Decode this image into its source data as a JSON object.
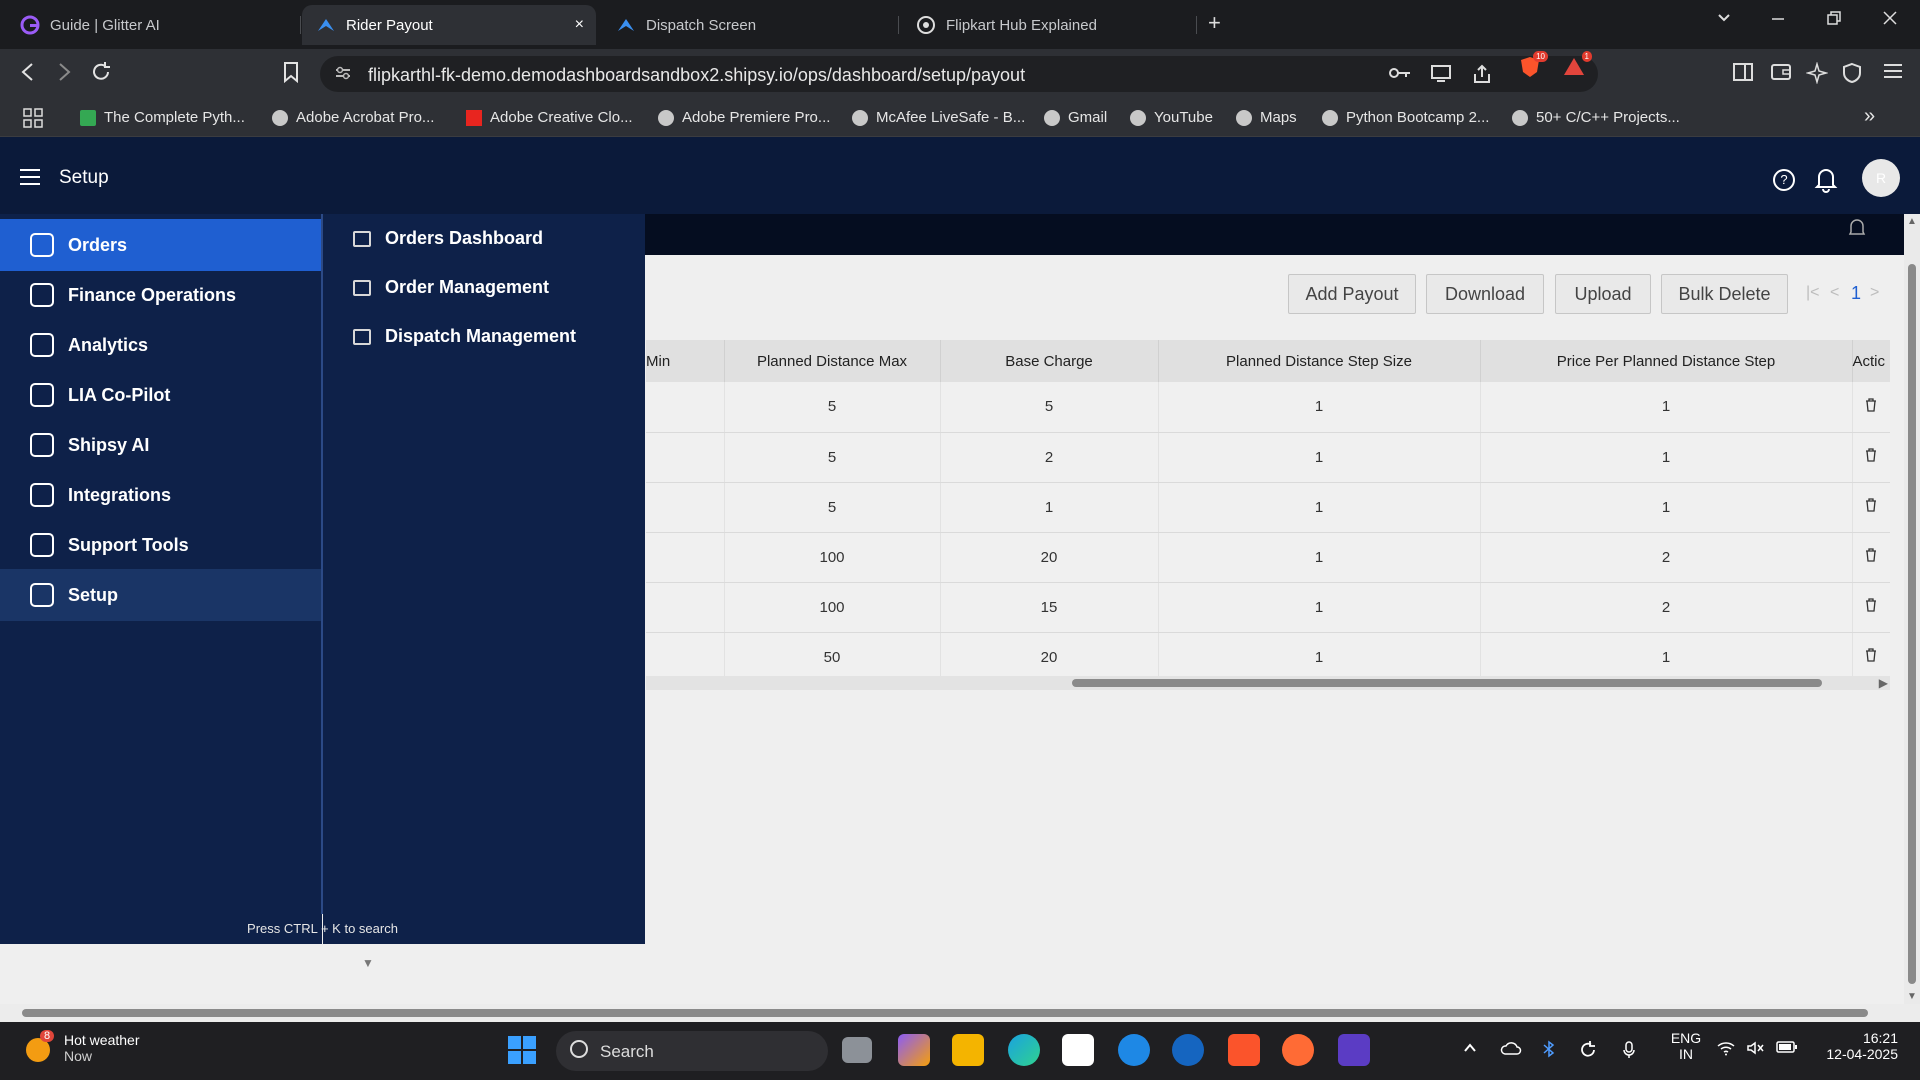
{
  "browser": {
    "tabs": [
      {
        "title": "Guide | Glitter AI",
        "active": false
      },
      {
        "title": "Rider Payout",
        "active": true
      },
      {
        "title": "Dispatch Screen",
        "active": false
      },
      {
        "title": "Flipkart Hub Explained",
        "active": false
      }
    ],
    "close_glyph": "×",
    "new_tab_glyph": "+",
    "url": "flipkarthl-fk-demo.demodashboardsandbox2.shipsy.io/ops/dashboard/setup/payout",
    "brave_badge": "10",
    "alert_badge": "1",
    "bookmarks": [
      "The Complete Pyth...",
      "Adobe Acrobat Pro...",
      "Adobe Creative Clo...",
      "Adobe Premiere Pro...",
      "McAfee LiveSafe - B...",
      "Gmail",
      "YouTube",
      "Maps",
      "Python Bootcamp 2...",
      "50+ C/C++ Projects..."
    ],
    "more_bookmarks_glyph": "»"
  },
  "app": {
    "title": "Setup",
    "help_glyph": "?",
    "avatar_initial": "R"
  },
  "sidebar": {
    "items": [
      {
        "label": "Orders",
        "icon": "box-icon"
      },
      {
        "label": "Finance Operations",
        "icon": "finance-icon"
      },
      {
        "label": "Analytics",
        "icon": "pie-chart-icon"
      },
      {
        "label": "LIA Co-Pilot",
        "icon": "copilot-icon"
      },
      {
        "label": "Shipsy AI",
        "icon": "brain-icon"
      },
      {
        "label": "Integrations",
        "icon": "integration-icon"
      },
      {
        "label": "Support Tools",
        "icon": "headset-icon"
      },
      {
        "label": "Setup",
        "icon": "gear-icon"
      }
    ],
    "submenu": [
      {
        "label": "Orders Dashboard",
        "icon": "list-icon"
      },
      {
        "label": "Order Management",
        "icon": "document-icon"
      },
      {
        "label": "Dispatch Management",
        "icon": "table-icon"
      }
    ],
    "search_hint": "Press CTRL + K to search"
  },
  "toolbar": {
    "add_payout": "Add Payout",
    "download": "Download",
    "upload": "Upload",
    "bulk_delete": "Bulk Delete",
    "pager_first": "|<",
    "pager_prev": "<",
    "page": "1",
    "pager_next": ">"
  },
  "table": {
    "headers": [
      "Min",
      "Planned Distance Max",
      "Base Charge",
      "Planned Distance Step Size",
      "Price Per Planned Distance Step",
      "Actic"
    ],
    "rows": [
      [
        "",
        "5",
        "5",
        "1",
        "1"
      ],
      [
        "",
        "5",
        "2",
        "1",
        "1"
      ],
      [
        "",
        "5",
        "1",
        "1",
        "1"
      ],
      [
        "",
        "100",
        "20",
        "1",
        "2"
      ],
      [
        "",
        "100",
        "15",
        "1",
        "2"
      ],
      [
        "",
        "50",
        "20",
        "1",
        "1"
      ]
    ]
  },
  "taskbar": {
    "weather_title": "Hot weather",
    "weather_sub": "Now",
    "weather_badge": "8",
    "search_placeholder": "Search",
    "lang_top": "ENG",
    "lang_bottom": "IN",
    "time": "16:21",
    "date": "12-04-2025"
  },
  "colors": {
    "sidebar_bg": "#0e2149",
    "active_item": "#1f5fd1",
    "header_bg": "#0b1a3a"
  }
}
